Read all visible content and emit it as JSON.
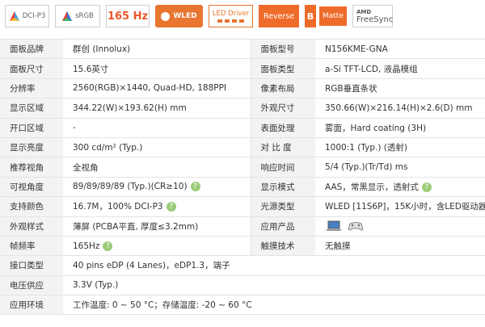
{
  "badges": {
    "dci_p3": "DCI-P3",
    "srgb": "sRGB",
    "refresh": "165 Hz",
    "wled": "WLED",
    "led_driver": "LED Driver",
    "reverse": "Reverse",
    "matte_b": "B",
    "matte": "Matte",
    "amd": "AMD",
    "freesync": "FreeSync"
  },
  "specs": [
    {
      "label": "面板品牌",
      "value": "群创 (Innolux)",
      "label2": "面板型号",
      "value2": "N156KME-GNA"
    },
    {
      "label": "面板尺寸",
      "value": "15.6英寸",
      "label2": "面板类型",
      "value2": "a-Si TFT-LCD, 液晶模组"
    },
    {
      "label": "分辨率",
      "value": "2560(RGB)×1440, Quad-HD, 188PPI",
      "label2": "像素布局",
      "value2": "RGB垂直条状"
    },
    {
      "label": "显示区域",
      "value": "344.22(W)×193.62(H) mm",
      "label2": "外观尺寸",
      "value2": "350.66(W)×216.14(H)×2.6(D) mm"
    },
    {
      "label": "开口区域",
      "value": "-",
      "label2": "表面处理",
      "value2": "雾面，Hard coating (3H)"
    },
    {
      "label": "显示亮度",
      "value": "300 cd/m² (Typ.)",
      "label2": "对 比 度",
      "value2": "1000:1 (Typ.) (透射)"
    },
    {
      "label": "推荐视角",
      "value": "全视角",
      "label2": "响应时间",
      "value2": "5/4 (Typ.)(Tr/Td) ms"
    },
    {
      "label": "可视角度",
      "value": "89/89/89/89 (Typ.)(CR≥10)",
      "label2": "显示模式",
      "value2": "AAS，常黑显示，透射式"
    },
    {
      "label": "支持颜色",
      "value": "16.7M，100% DCI-P3",
      "label2": "光源类型",
      "value2": "WLED  [11S6P]，15K小时，含LED驱动器"
    },
    {
      "label": "外观样式",
      "value": "薄屏 (PCBA平直, 厚度≤3.2mm)",
      "label2": "应用产品",
      "value2": ""
    },
    {
      "label": "帧频率",
      "value": "165Hz",
      "label2": "触摸技术",
      "value2": "无触摸"
    },
    {
      "label": "接口类型",
      "value": "40 pins   eDP (4 Lanes)，eDP1.3，端子"
    },
    {
      "label": "电压供应",
      "value": "3.3V (Typ.)"
    },
    {
      "label": "应用环境",
      "value": "工作温度: 0 ~ 50 °C；存储温度: -20 ~ 60 °C"
    }
  ],
  "icons": {
    "help": "question-mark-circle",
    "app_products": [
      "laptop-icon",
      "gamepad-icon"
    ]
  },
  "colors": {
    "accent_orange": "#ee6b2a",
    "help_green": "#9ccb7a",
    "label_bg": "#f3f3f3",
    "refresh_text": "#e8572a"
  }
}
